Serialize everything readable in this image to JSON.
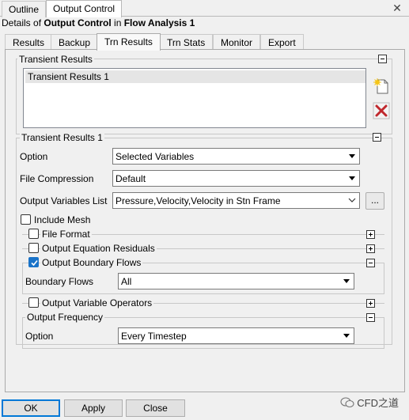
{
  "top_tabs": [
    "Outline",
    "Output Control"
  ],
  "details": {
    "prefix": "Details of",
    "object": "Output Control",
    "mid": "in",
    "parent": "Flow Analysis 1"
  },
  "sub_tabs": [
    "Results",
    "Backup",
    "Trn Results",
    "Trn Stats",
    "Monitor",
    "Export"
  ],
  "transient_results": {
    "title": "Transient Results",
    "items": [
      "Transient Results 1"
    ]
  },
  "tr1": {
    "title": "Transient Results 1",
    "option_label": "Option",
    "option_value": "Selected Variables",
    "file_compression_label": "File Compression",
    "file_compression_value": "Default",
    "output_vars_label": "Output Variables List",
    "output_vars_value": "Pressure,Velocity,Velocity in Stn Frame",
    "dots_label": "...",
    "include_mesh": "Include Mesh",
    "file_format": "File Format",
    "output_eq_residuals": "Output Equation Residuals",
    "output_boundary_flows": "Output Boundary Flows",
    "boundary_flows_label": "Boundary Flows",
    "boundary_flows_value": "All",
    "output_variable_operators": "Output Variable Operators",
    "output_frequency": "Output Frequency",
    "freq_option_label": "Option",
    "freq_option_value": "Every Timestep"
  },
  "buttons": {
    "ok": "OK",
    "apply": "Apply",
    "close": "Close"
  },
  "watermark": "CFD之道",
  "colors": {
    "accent": "#0078d7",
    "checkbox": "#1a73c8",
    "delete": "#c0282d"
  }
}
